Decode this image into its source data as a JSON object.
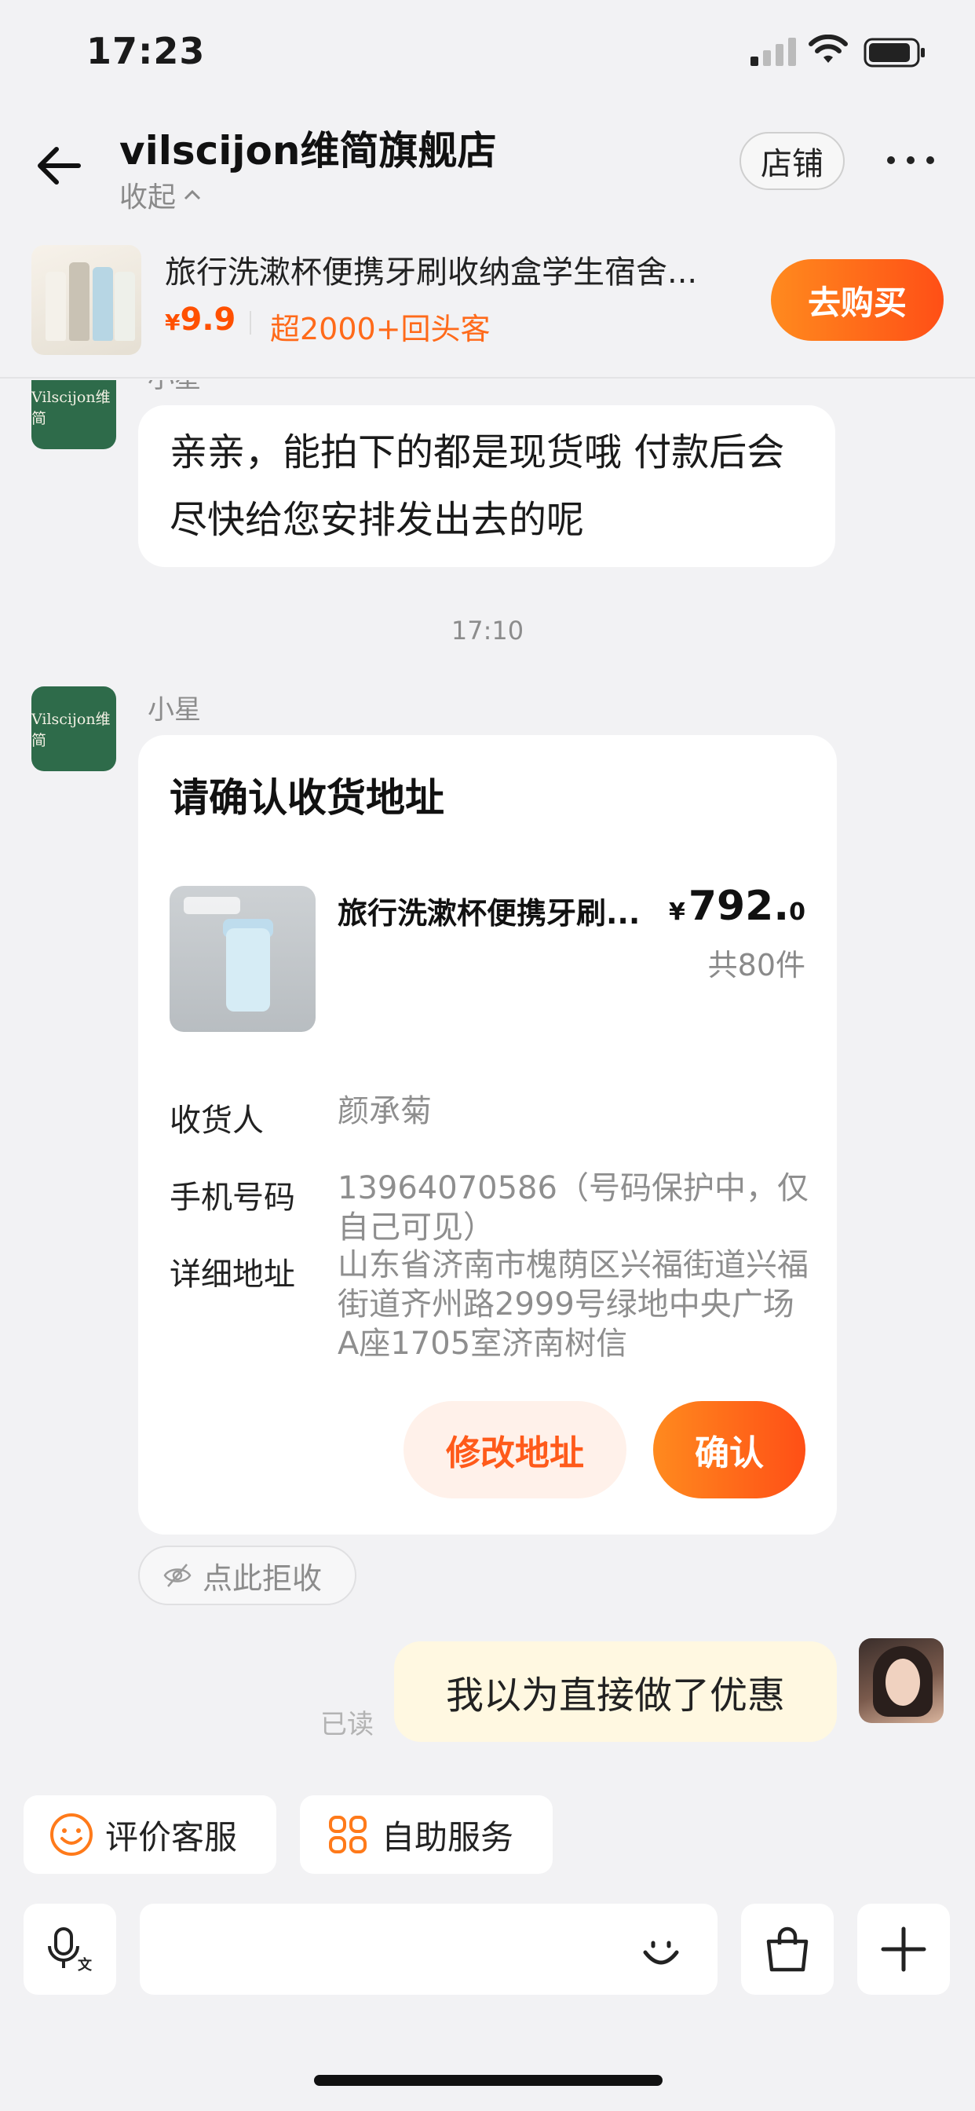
{
  "status_bar": {
    "time": "17:23"
  },
  "header": {
    "shop_name": "vilscijon维简旗舰店",
    "collapse_label": "收起",
    "store_button": "店铺"
  },
  "product": {
    "name": "旅行洗漱杯便携牙刷收纳盒学生宿舍...",
    "price_symbol": "¥",
    "price": "9.9",
    "repeat_tag": "超2000+回头客",
    "buy_button": "去购买"
  },
  "chat": {
    "shop_avatar_text": "Vilscijon维简",
    "sender_name": "小星",
    "messages": [
      {
        "text": "亲亲，能拍下的都是现货哦 付款后会尽快给您安排发出去的呢"
      }
    ],
    "timestamp": "17:10",
    "address_card": {
      "title": "请确认收货地址",
      "item_name": "旅行洗漱杯便携牙刷...",
      "price_symbol": "¥",
      "price_int": "792.",
      "price_dec": "0",
      "quantity": "共80件",
      "recipient_label": "收货人",
      "recipient_value": "颜承菊",
      "phone_label": "手机号码",
      "phone_value": "13964070586（号码保护中，仅自己可见）",
      "address_label": "详细地址",
      "address_value": "山东省济南市槐荫区兴福街道兴福街道齐州路2999号绿地中央广场A座1705室济南树信",
      "modify_button": "修改地址",
      "confirm_button": "确认"
    },
    "reject_label": "点此拒收",
    "my_message": "我以为直接做了优惠",
    "read_status": "已读"
  },
  "quick_actions": [
    {
      "label": "评价客服",
      "icon": "smile-icon"
    },
    {
      "label": "自助服务",
      "icon": "grid-icon"
    }
  ],
  "input": {
    "placeholder": ""
  },
  "colors": {
    "accent": "#ff5000",
    "shop_avatar": "#2e6b4a",
    "my_bubble": "#fff8e1"
  }
}
